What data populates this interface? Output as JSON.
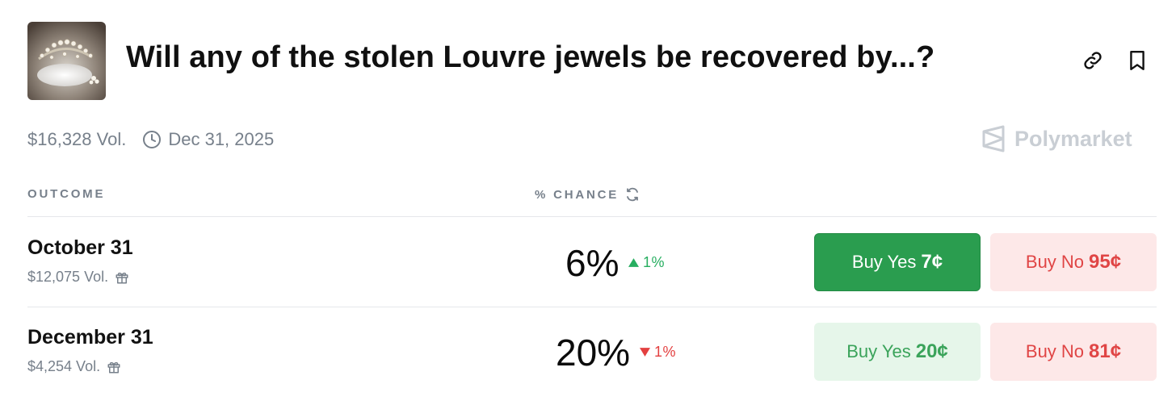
{
  "market": {
    "title": "Will any of the stolen Louvre jewels be recovered by...?",
    "volume": "$16,328 Vol.",
    "end_date": "Dec 31, 2025",
    "brand": "Polymarket"
  },
  "icons": {
    "link": "link-icon",
    "bookmark": "bookmark-icon",
    "clock": "clock-icon",
    "gift": "gift-icon",
    "refresh": "refresh-icon",
    "brand": "polymarket-logo-icon"
  },
  "table": {
    "col_outcome": "OUTCOME",
    "col_chance": "% CHANCE"
  },
  "outcomes": [
    {
      "name": "October 31",
      "volume": "$12,075 Vol.",
      "chance": "6%",
      "delta": "1%",
      "delta_dir": "up",
      "yes_label": "Buy Yes",
      "yes_price": "7¢",
      "no_label": "Buy No",
      "no_price": "95¢"
    },
    {
      "name": "December 31",
      "volume": "$4,254 Vol.",
      "chance": "20%",
      "delta": "1%",
      "delta_dir": "down",
      "yes_label": "Buy Yes",
      "yes_price": "20¢",
      "no_label": "Buy No",
      "no_price": "81¢"
    }
  ],
  "colors": {
    "yes_green": "#2a9d4f",
    "yes_soft": "#e6f6ea",
    "no_soft": "#fde8e8",
    "no_red": "#e04545",
    "up": "#27ae60",
    "down": "#e34040"
  }
}
